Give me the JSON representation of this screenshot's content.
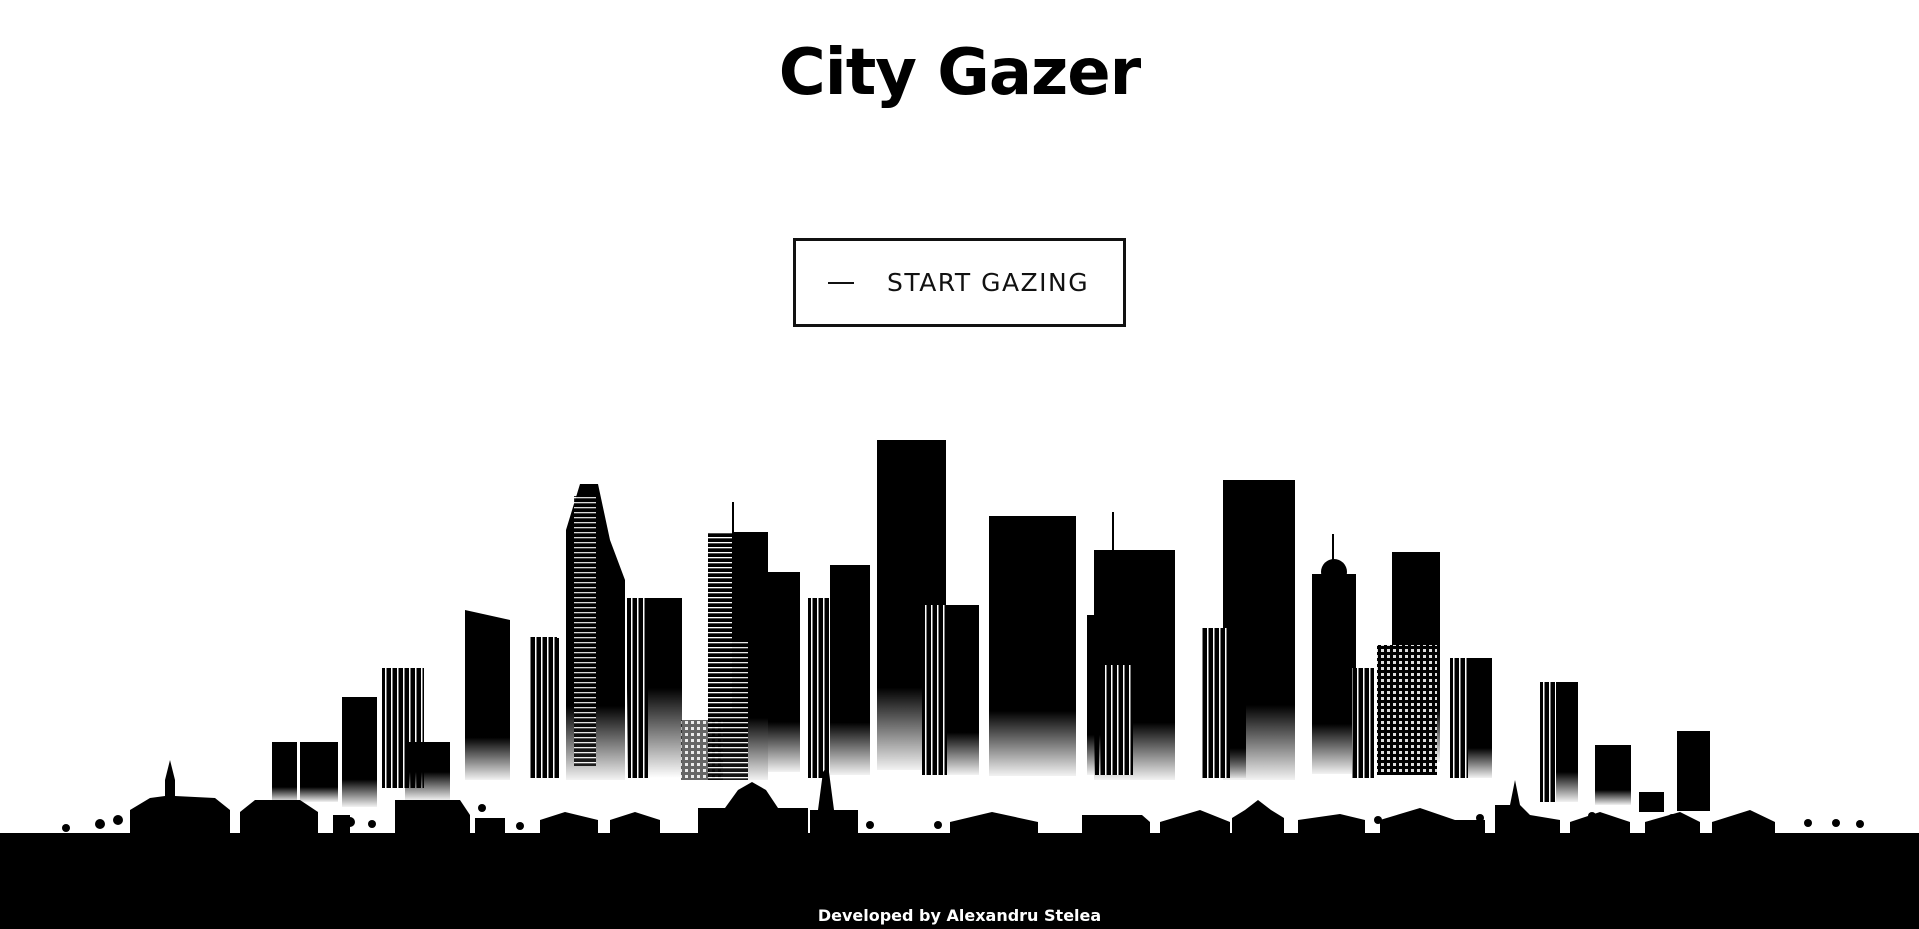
{
  "page": {
    "title": "City Gazer",
    "cta": {
      "label": "START GAZING"
    },
    "footer": {
      "credit": "Developed by Alexandru Stelea"
    }
  },
  "theme": {
    "background": "#ffffff",
    "foreground": "#000000"
  },
  "icons": {
    "cta_icon": "dash-icon"
  }
}
